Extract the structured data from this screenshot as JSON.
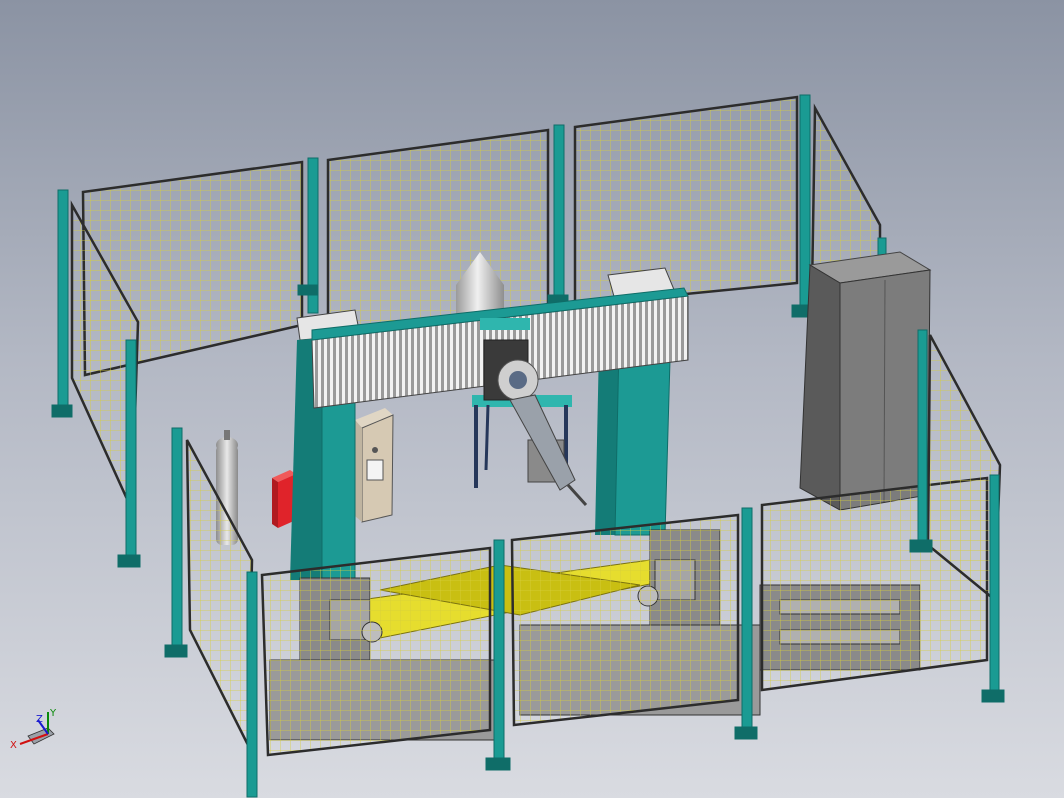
{
  "viewport": {
    "background_top": "#8b93a3",
    "background_bottom": "#d9dbe1"
  },
  "colors": {
    "post": "#1a9b93",
    "post_dark": "#0f6d68",
    "mesh": "#d7cf3c",
    "frame": "#2c2c2c",
    "gantry": "#1c9a94",
    "beam": "#d7d7d7",
    "workpiece": "#e6dd2e",
    "cabinet": "#7c7c7c",
    "cabinet_dark": "#5a5a5a",
    "red_box": "#e0232a",
    "tank": "#c7c7c7"
  },
  "scene_objects": [
    "safety-fence-panels",
    "fence-posts",
    "gantry-columns",
    "gantry-beam",
    "welding-robot",
    "control-box",
    "gas-cylinder",
    "electrical-cabinet",
    "positioner-frame",
    "yellow-workpiece",
    "cone-hopper",
    "red-box"
  ],
  "triad": {
    "x_label": "X",
    "y_label": "Y",
    "z_label": "Z"
  }
}
